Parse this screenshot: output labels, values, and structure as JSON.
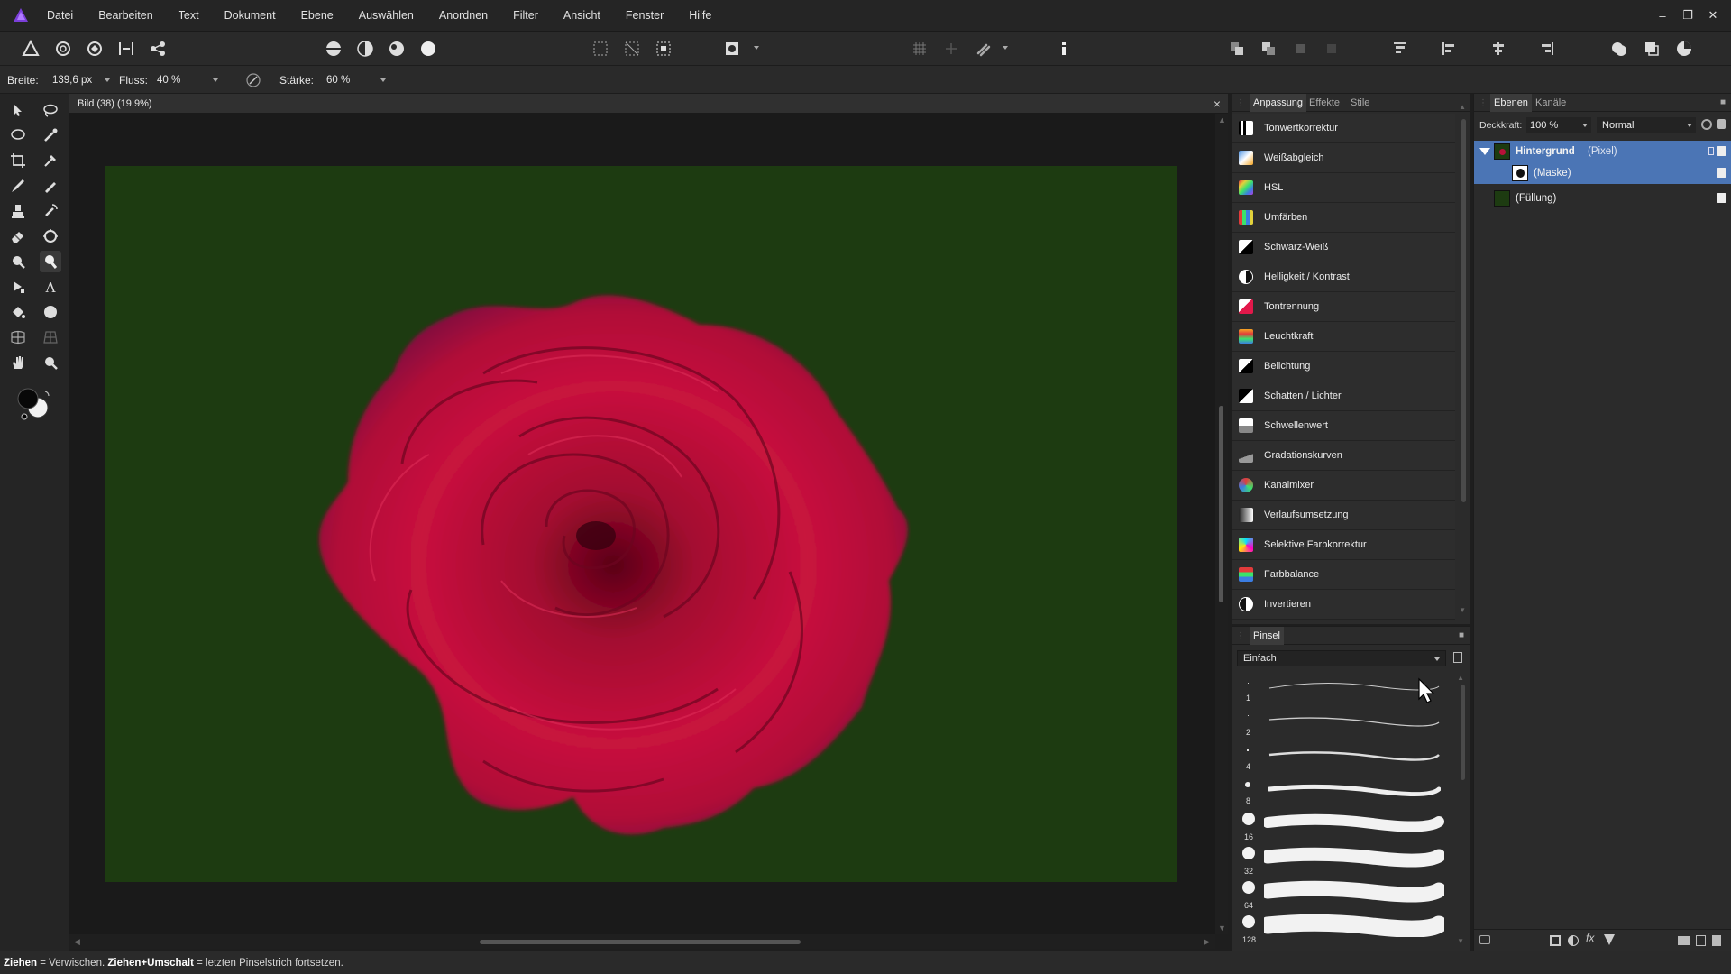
{
  "menu": [
    "Datei",
    "Bearbeiten",
    "Text",
    "Dokument",
    "Ebene",
    "Auswählen",
    "Anordnen",
    "Filter",
    "Ansicht",
    "Fenster",
    "Hilfe"
  ],
  "context": {
    "width_label": "Breite:",
    "width_value": "139,6 px",
    "flow_label": "Fluss:",
    "flow_value": "40 %",
    "strength_label": "Stärke:",
    "strength_value": "60 %"
  },
  "document": {
    "title": "Bild (38) (19.9%)"
  },
  "adjustments": {
    "tabs": [
      "Anpassung",
      "Effekte",
      "Stile"
    ],
    "items": [
      {
        "label": "Tonwertkorrektur",
        "icon": "levels-icon"
      },
      {
        "label": "Weißabgleich",
        "icon": "white-balance-icon"
      },
      {
        "label": "HSL",
        "icon": "hsl-icon"
      },
      {
        "label": "Umfärben",
        "icon": "recolor-icon"
      },
      {
        "label": "Schwarz-Weiß",
        "icon": "black-white-icon"
      },
      {
        "label": "Helligkeit / Kontrast",
        "icon": "brightness-contrast-icon"
      },
      {
        "label": "Tontrennung",
        "icon": "posterize-icon"
      },
      {
        "label": "Leuchtkraft",
        "icon": "vibrance-icon"
      },
      {
        "label": "Belichtung",
        "icon": "exposure-icon"
      },
      {
        "label": "Schatten / Lichter",
        "icon": "shadows-highlights-icon"
      },
      {
        "label": "Schwellenwert",
        "icon": "threshold-icon"
      },
      {
        "label": "Gradationskurven",
        "icon": "curves-icon"
      },
      {
        "label": "Kanalmixer",
        "icon": "channel-mixer-icon"
      },
      {
        "label": "Verlaufsumsetzung",
        "icon": "gradient-map-icon"
      },
      {
        "label": "Selektive Farbkorrektur",
        "icon": "selective-color-icon"
      },
      {
        "label": "Farbbalance",
        "icon": "color-balance-icon"
      },
      {
        "label": "Invertieren",
        "icon": "invert-icon"
      }
    ]
  },
  "brushes": {
    "tab": "Pinsel",
    "category": "Einfach",
    "sizes": [
      "1",
      "2",
      "4",
      "8",
      "16",
      "32",
      "64",
      "128"
    ]
  },
  "layers": {
    "tabs": [
      "Ebenen",
      "Kanäle"
    ],
    "opacity_label": "Deckkraft:",
    "opacity_value": "100 %",
    "blend_mode": "Normal",
    "items": [
      {
        "name": "Hintergrund",
        "type": "(Pixel)"
      },
      {
        "name": "(Maske)"
      },
      {
        "name": "(Füllung)"
      }
    ]
  },
  "status": {
    "key1": "Ziehen",
    "text1": " = Verwischen. ",
    "key2": "Ziehen+Umschalt",
    "text2": " = letzten Pinselstrich fortsetzen."
  },
  "colors": {
    "image_background": "#1d3b11",
    "rose": "#b8103a",
    "layer_selected": "#4b75b5",
    "app_accent": "#7b3fd9"
  }
}
